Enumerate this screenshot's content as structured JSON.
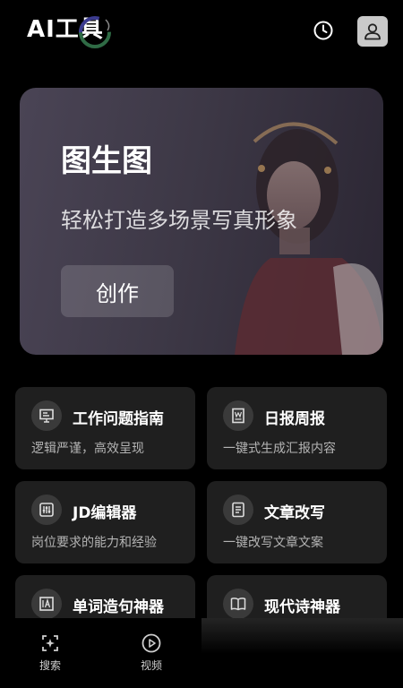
{
  "header": {
    "title": "AI工具",
    "history_icon": "clock-icon",
    "profile_icon": "user-icon"
  },
  "banner": {
    "title": "图生图",
    "subtitle": "轻松打造多场景写真形象",
    "button_label": "创作"
  },
  "tools": [
    {
      "title": "工作问题指南",
      "desc": "逻辑严谨，高效呈现",
      "icon": "presentation-icon"
    },
    {
      "title": "日报周报",
      "desc": "一键式生成汇报内容",
      "icon": "word-document-icon"
    },
    {
      "title": "JD编辑器",
      "desc": "岗位要求的能力和经验",
      "icon": "sliders-icon"
    },
    {
      "title": "文章改写",
      "desc": "一键改写文章文案",
      "icon": "document-icon"
    },
    {
      "title": "单词造句神器",
      "desc": "",
      "icon": "image-text-icon"
    },
    {
      "title": "现代诗神器",
      "desc": "",
      "icon": "book-icon"
    }
  ],
  "tabbar": {
    "items": [
      {
        "label": "搜索",
        "icon": "sparkle-search-icon"
      },
      {
        "label": "视频",
        "icon": "play-circle-icon"
      }
    ]
  },
  "colors": {
    "background": "#000000",
    "card": "#1f1f1f",
    "banner": "#3d3846"
  }
}
